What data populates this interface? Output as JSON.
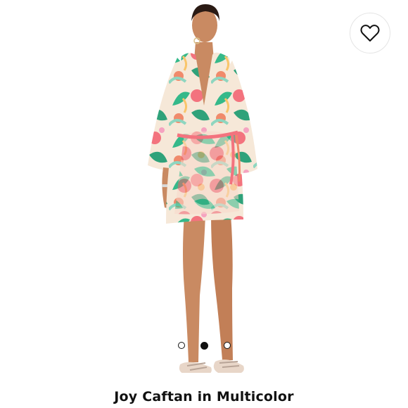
{
  "product": {
    "title": "Joy Caftan in Multicolor"
  },
  "gallery": {
    "image_count": 3,
    "active_index": 1
  },
  "icons": {
    "wishlist": "heart-icon"
  },
  "colors": {
    "dot_active": "#111111",
    "print_pink": "#f3737e",
    "print_green": "#35b98a",
    "print_coral": "#f08a6b"
  }
}
